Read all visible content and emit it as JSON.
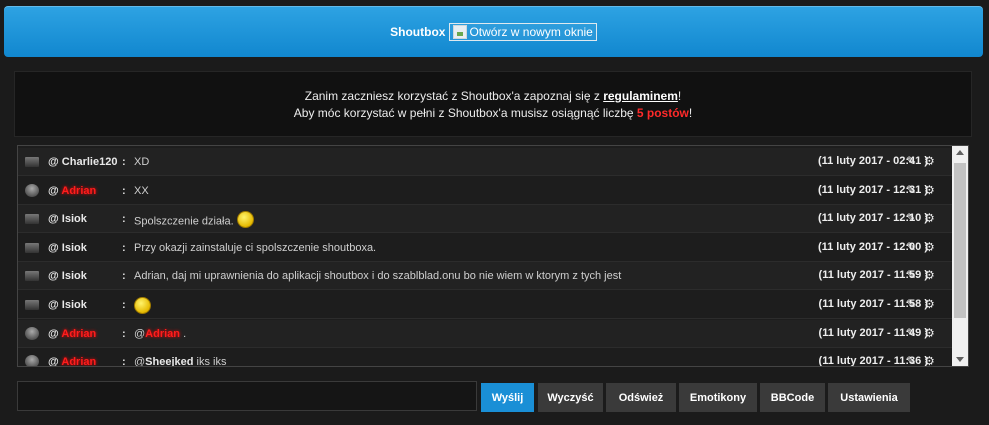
{
  "header": {
    "title": "Shoutbox",
    "link_text": "Otwórz w nowym oknie"
  },
  "notice": {
    "line1_before": "Zanim zaczniesz korzystać z Shoutbox'a zapoznaj się z ",
    "line1_link": "regulaminem",
    "line1_after": "!",
    "line2_before": "Aby móc korzystać w pełni z Shoutbox'a musisz osiągnąć liczbę ",
    "line2_red": "5 postów",
    "line2_after": "!"
  },
  "shouts": [
    {
      "avatar": "robot",
      "user_prefix": "@ ",
      "user": "Charlie120",
      "user_red": false,
      "msg": "XD",
      "date": "(11 luty 2017 - 02:41 )"
    },
    {
      "avatar": "person",
      "user_prefix": "@ ",
      "user": "Adrian",
      "user_red": true,
      "msg": "XX",
      "date": "(11 luty 2017 - 12:31 )"
    },
    {
      "avatar": "robot",
      "user_prefix": "@ ",
      "user": "Isiok",
      "user_red": false,
      "msg": "Spolszczenie działa.",
      "smiley": true,
      "date": "(11 luty 2017 - 12:10 )"
    },
    {
      "avatar": "robot",
      "user_prefix": "@ ",
      "user": "Isiok",
      "user_red": false,
      "msg": "Przy okazji zainstaluje ci spolszczenie shoutboxa.",
      "date": "(11 luty 2017 - 12:00 )"
    },
    {
      "avatar": "robot",
      "user_prefix": "@ ",
      "user": "Isiok",
      "user_red": false,
      "msg": "Adrian, daj mi uprawnienia do aplikacji shoutbox i do szablblad.onu bo nie wiem w ktorym z tych jest",
      "date": "(11 luty 2017 - 11:59 )"
    },
    {
      "avatar": "robot",
      "user_prefix": "@ ",
      "user": "Isiok",
      "user_red": false,
      "msg": "",
      "smiley": true,
      "date": "(11 luty 2017 - 11:58 )"
    },
    {
      "avatar": "person",
      "user_prefix": "@ ",
      "user": "Adrian",
      "user_red": true,
      "msg_mention": "Adrian",
      "msg_mention_red": true,
      "msg": ".",
      "date": "(11 luty 2017 - 11:49 )"
    },
    {
      "avatar": "person",
      "user_prefix": "@ ",
      "user": "Adrian",
      "user_red": true,
      "msg_mention": "Sheejked",
      "msg_mention_red": false,
      "msg": "iks iks",
      "date": "(11 luty 2017 - 11:36 )"
    }
  ],
  "buttons": {
    "send": "Wyślij",
    "clear": "Wyczyść",
    "refresh": "Odśwież",
    "emoticons": "Emotikony",
    "bbcode": "BBCode",
    "settings": "Ustawienia"
  },
  "icons": {
    "edit": "edit-icon",
    "gear": "gear-icon"
  },
  "colors": {
    "accent": "#1a8fd6",
    "admin_name": "#ff1d1d"
  }
}
